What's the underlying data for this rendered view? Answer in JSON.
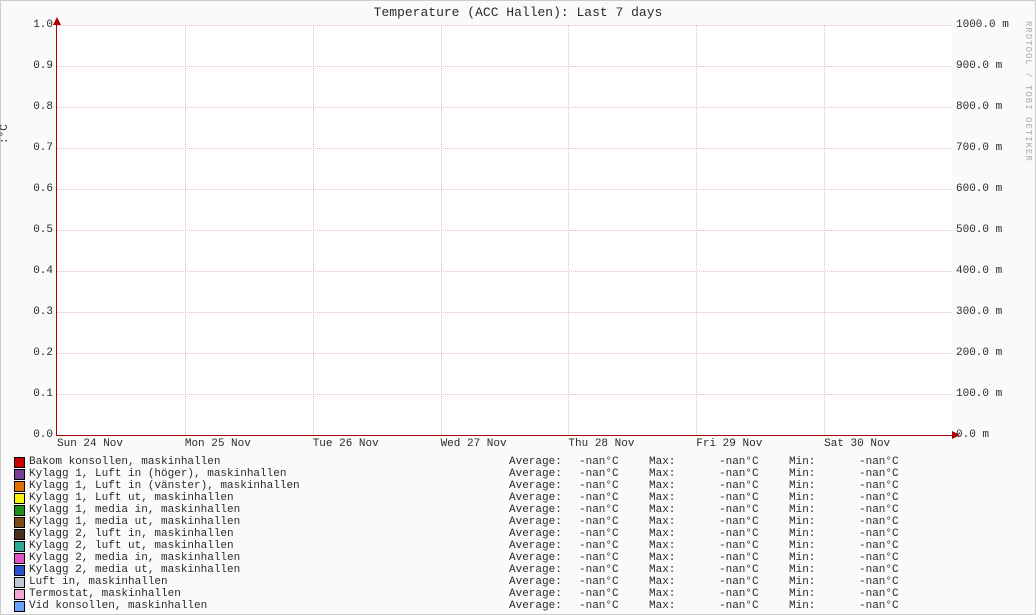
{
  "title": "Temperature (ACC Hallen): Last 7 days",
  "watermark": "RRDTOOL / TOBI OETIKER",
  "ylabel": ":°C",
  "chart_data": {
    "type": "line",
    "title": "Temperature (ACC Hallen): Last 7 days",
    "xlabel": "",
    "ylabel": ":°C",
    "y2label": "m",
    "ylim": [
      0.0,
      1.0
    ],
    "y2lim": [
      0.0,
      1000.0
    ],
    "x_ticks": [
      "Sun 24 Nov",
      "Mon 25 Nov",
      "Tue 26 Nov",
      "Wed 27 Nov",
      "Thu 28 Nov",
      "Fri 29 Nov",
      "Sat 30 Nov"
    ],
    "y_ticks": [
      "0.0",
      "0.1",
      "0.2",
      "0.3",
      "0.4",
      "0.5",
      "0.6",
      "0.7",
      "0.8",
      "0.9",
      "1.0"
    ],
    "y2_ticks": [
      "0.0 m",
      "100.0 m",
      "200.0 m",
      "300.0 m",
      "400.0 m",
      "500.0 m",
      "600.0 m",
      "700.0 m",
      "800.0 m",
      "900.0 m",
      "1000.0 m"
    ],
    "series": [
      {
        "name": "Bakom konsollen, maskinhallen",
        "color": "#cc0000",
        "avg": "-nan°C",
        "max": "-nan°C",
        "min": "-nan°C"
      },
      {
        "name": "Kylagg 1, Luft in (höger), maskinhallen",
        "color": "#7a3e98",
        "avg": "-nan°C",
        "max": "-nan°C",
        "min": "-nan°C"
      },
      {
        "name": "Kylagg 1, Luft in (vänster), maskinhallen",
        "color": "#e07000",
        "avg": "-nan°C",
        "max": "-nan°C",
        "min": "-nan°C"
      },
      {
        "name": "Kylagg 1, Luft ut, maskinhallen",
        "color": "#f7f200",
        "avg": "-nan°C",
        "max": "-nan°C",
        "min": "-nan°C"
      },
      {
        "name": "Kylagg 1, media in, maskinhallen",
        "color": "#1a8f1a",
        "avg": "-nan°C",
        "max": "-nan°C",
        "min": "-nan°C"
      },
      {
        "name": "Kylagg 1, media ut, maskinhallen",
        "color": "#7a4b1a",
        "avg": "-nan°C",
        "max": "-nan°C",
        "min": "-nan°C"
      },
      {
        "name": "Kylagg 2, luft in, maskinhallen",
        "color": "#4a3020",
        "avg": "-nan°C",
        "max": "-nan°C",
        "min": "-nan°C"
      },
      {
        "name": "Kylagg 2, luft ut, maskinhallen",
        "color": "#2aa89a",
        "avg": "-nan°C",
        "max": "-nan°C",
        "min": "-nan°C"
      },
      {
        "name": "Kylagg 2, media in, maskinhallen",
        "color": "#e352c6",
        "avg": "-nan°C",
        "max": "-nan°C",
        "min": "-nan°C"
      },
      {
        "name": "Kylagg 2, media ut, maskinhallen",
        "color": "#2a4fd0",
        "avg": "-nan°C",
        "max": "-nan°C",
        "min": "-nan°C"
      },
      {
        "name": "Luft in, maskinhallen",
        "color": "#bfc6d6",
        "avg": "-nan°C",
        "max": "-nan°C",
        "min": "-nan°C"
      },
      {
        "name": "Termostat, maskinhallen",
        "color": "#f0a8d6",
        "avg": "-nan°C",
        "max": "-nan°C",
        "min": "-nan°C"
      },
      {
        "name": "Vid konsollen, maskinhallen",
        "color": "#6aa0ff",
        "avg": "-nan°C",
        "max": "-nan°C",
        "min": "-nan°C"
      }
    ],
    "legend_labels": {
      "avg": "Average:",
      "max": "Max:",
      "min": "Min:"
    }
  }
}
